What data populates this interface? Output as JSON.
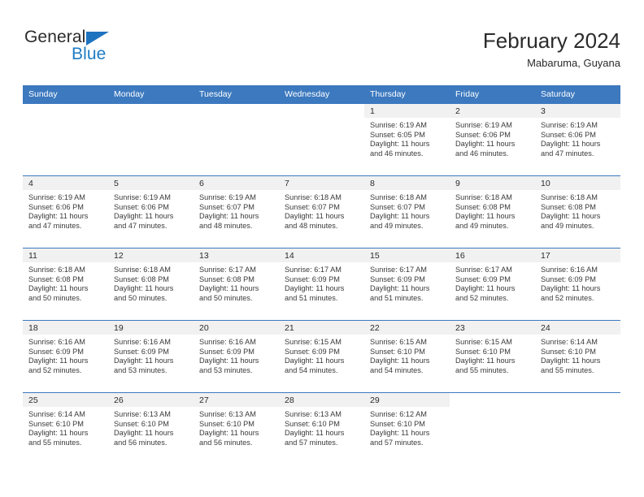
{
  "brand": {
    "name_top": "General",
    "name_bottom": "Blue",
    "triangle_icon": "blue-triangle-logo-mark",
    "accent_color": "#1e7bc4"
  },
  "header": {
    "title": "February 2024",
    "subtitle": "Mabaruma, Guyana"
  },
  "colors": {
    "header_blue": "#3c79bf",
    "daynum_band": "#f1f1f1",
    "text": "#2b2b2b"
  },
  "weekday_headers": [
    "Sunday",
    "Monday",
    "Tuesday",
    "Wednesday",
    "Thursday",
    "Friday",
    "Saturday"
  ],
  "labels": {
    "sunrise_prefix": "Sunrise:",
    "sunset_prefix": "Sunset:",
    "daylight_prefix": "Daylight:"
  },
  "weeks": [
    [
      {
        "day": "",
        "sunrise": "",
        "sunset": "",
        "daylight_line1": "",
        "daylight_line2": "",
        "empty": true
      },
      {
        "day": "",
        "sunrise": "",
        "sunset": "",
        "daylight_line1": "",
        "daylight_line2": "",
        "empty": true
      },
      {
        "day": "",
        "sunrise": "",
        "sunset": "",
        "daylight_line1": "",
        "daylight_line2": "",
        "empty": true
      },
      {
        "day": "",
        "sunrise": "",
        "sunset": "",
        "daylight_line1": "",
        "daylight_line2": "",
        "empty": true
      },
      {
        "day": "1",
        "sunrise": "Sunrise: 6:19 AM",
        "sunset": "Sunset: 6:05 PM",
        "daylight_line1": "Daylight: 11 hours",
        "daylight_line2": "and 46 minutes.",
        "empty": false
      },
      {
        "day": "2",
        "sunrise": "Sunrise: 6:19 AM",
        "sunset": "Sunset: 6:06 PM",
        "daylight_line1": "Daylight: 11 hours",
        "daylight_line2": "and 46 minutes.",
        "empty": false
      },
      {
        "day": "3",
        "sunrise": "Sunrise: 6:19 AM",
        "sunset": "Sunset: 6:06 PM",
        "daylight_line1": "Daylight: 11 hours",
        "daylight_line2": "and 47 minutes.",
        "empty": false
      }
    ],
    [
      {
        "day": "4",
        "sunrise": "Sunrise: 6:19 AM",
        "sunset": "Sunset: 6:06 PM",
        "daylight_line1": "Daylight: 11 hours",
        "daylight_line2": "and 47 minutes.",
        "empty": false
      },
      {
        "day": "5",
        "sunrise": "Sunrise: 6:19 AM",
        "sunset": "Sunset: 6:06 PM",
        "daylight_line1": "Daylight: 11 hours",
        "daylight_line2": "and 47 minutes.",
        "empty": false
      },
      {
        "day": "6",
        "sunrise": "Sunrise: 6:19 AM",
        "sunset": "Sunset: 6:07 PM",
        "daylight_line1": "Daylight: 11 hours",
        "daylight_line2": "and 48 minutes.",
        "empty": false
      },
      {
        "day": "7",
        "sunrise": "Sunrise: 6:18 AM",
        "sunset": "Sunset: 6:07 PM",
        "daylight_line1": "Daylight: 11 hours",
        "daylight_line2": "and 48 minutes.",
        "empty": false
      },
      {
        "day": "8",
        "sunrise": "Sunrise: 6:18 AM",
        "sunset": "Sunset: 6:07 PM",
        "daylight_line1": "Daylight: 11 hours",
        "daylight_line2": "and 49 minutes.",
        "empty": false
      },
      {
        "day": "9",
        "sunrise": "Sunrise: 6:18 AM",
        "sunset": "Sunset: 6:08 PM",
        "daylight_line1": "Daylight: 11 hours",
        "daylight_line2": "and 49 minutes.",
        "empty": false
      },
      {
        "day": "10",
        "sunrise": "Sunrise: 6:18 AM",
        "sunset": "Sunset: 6:08 PM",
        "daylight_line1": "Daylight: 11 hours",
        "daylight_line2": "and 49 minutes.",
        "empty": false
      }
    ],
    [
      {
        "day": "11",
        "sunrise": "Sunrise: 6:18 AM",
        "sunset": "Sunset: 6:08 PM",
        "daylight_line1": "Daylight: 11 hours",
        "daylight_line2": "and 50 minutes.",
        "empty": false
      },
      {
        "day": "12",
        "sunrise": "Sunrise: 6:18 AM",
        "sunset": "Sunset: 6:08 PM",
        "daylight_line1": "Daylight: 11 hours",
        "daylight_line2": "and 50 minutes.",
        "empty": false
      },
      {
        "day": "13",
        "sunrise": "Sunrise: 6:17 AM",
        "sunset": "Sunset: 6:08 PM",
        "daylight_line1": "Daylight: 11 hours",
        "daylight_line2": "and 50 minutes.",
        "empty": false
      },
      {
        "day": "14",
        "sunrise": "Sunrise: 6:17 AM",
        "sunset": "Sunset: 6:09 PM",
        "daylight_line1": "Daylight: 11 hours",
        "daylight_line2": "and 51 minutes.",
        "empty": false
      },
      {
        "day": "15",
        "sunrise": "Sunrise: 6:17 AM",
        "sunset": "Sunset: 6:09 PM",
        "daylight_line1": "Daylight: 11 hours",
        "daylight_line2": "and 51 minutes.",
        "empty": false
      },
      {
        "day": "16",
        "sunrise": "Sunrise: 6:17 AM",
        "sunset": "Sunset: 6:09 PM",
        "daylight_line1": "Daylight: 11 hours",
        "daylight_line2": "and 52 minutes.",
        "empty": false
      },
      {
        "day": "17",
        "sunrise": "Sunrise: 6:16 AM",
        "sunset": "Sunset: 6:09 PM",
        "daylight_line1": "Daylight: 11 hours",
        "daylight_line2": "and 52 minutes.",
        "empty": false
      }
    ],
    [
      {
        "day": "18",
        "sunrise": "Sunrise: 6:16 AM",
        "sunset": "Sunset: 6:09 PM",
        "daylight_line1": "Daylight: 11 hours",
        "daylight_line2": "and 52 minutes.",
        "empty": false
      },
      {
        "day": "19",
        "sunrise": "Sunrise: 6:16 AM",
        "sunset": "Sunset: 6:09 PM",
        "daylight_line1": "Daylight: 11 hours",
        "daylight_line2": "and 53 minutes.",
        "empty": false
      },
      {
        "day": "20",
        "sunrise": "Sunrise: 6:16 AM",
        "sunset": "Sunset: 6:09 PM",
        "daylight_line1": "Daylight: 11 hours",
        "daylight_line2": "and 53 minutes.",
        "empty": false
      },
      {
        "day": "21",
        "sunrise": "Sunrise: 6:15 AM",
        "sunset": "Sunset: 6:09 PM",
        "daylight_line1": "Daylight: 11 hours",
        "daylight_line2": "and 54 minutes.",
        "empty": false
      },
      {
        "day": "22",
        "sunrise": "Sunrise: 6:15 AM",
        "sunset": "Sunset: 6:10 PM",
        "daylight_line1": "Daylight: 11 hours",
        "daylight_line2": "and 54 minutes.",
        "empty": false
      },
      {
        "day": "23",
        "sunrise": "Sunrise: 6:15 AM",
        "sunset": "Sunset: 6:10 PM",
        "daylight_line1": "Daylight: 11 hours",
        "daylight_line2": "and 55 minutes.",
        "empty": false
      },
      {
        "day": "24",
        "sunrise": "Sunrise: 6:14 AM",
        "sunset": "Sunset: 6:10 PM",
        "daylight_line1": "Daylight: 11 hours",
        "daylight_line2": "and 55 minutes.",
        "empty": false
      }
    ],
    [
      {
        "day": "25",
        "sunrise": "Sunrise: 6:14 AM",
        "sunset": "Sunset: 6:10 PM",
        "daylight_line1": "Daylight: 11 hours",
        "daylight_line2": "and 55 minutes.",
        "empty": false
      },
      {
        "day": "26",
        "sunrise": "Sunrise: 6:13 AM",
        "sunset": "Sunset: 6:10 PM",
        "daylight_line1": "Daylight: 11 hours",
        "daylight_line2": "and 56 minutes.",
        "empty": false
      },
      {
        "day": "27",
        "sunrise": "Sunrise: 6:13 AM",
        "sunset": "Sunset: 6:10 PM",
        "daylight_line1": "Daylight: 11 hours",
        "daylight_line2": "and 56 minutes.",
        "empty": false
      },
      {
        "day": "28",
        "sunrise": "Sunrise: 6:13 AM",
        "sunset": "Sunset: 6:10 PM",
        "daylight_line1": "Daylight: 11 hours",
        "daylight_line2": "and 57 minutes.",
        "empty": false
      },
      {
        "day": "29",
        "sunrise": "Sunrise: 6:12 AM",
        "sunset": "Sunset: 6:10 PM",
        "daylight_line1": "Daylight: 11 hours",
        "daylight_line2": "and 57 minutes.",
        "empty": false
      },
      {
        "day": "",
        "sunrise": "",
        "sunset": "",
        "daylight_line1": "",
        "daylight_line2": "",
        "empty": true
      },
      {
        "day": "",
        "sunrise": "",
        "sunset": "",
        "daylight_line1": "",
        "daylight_line2": "",
        "empty": true
      }
    ]
  ]
}
